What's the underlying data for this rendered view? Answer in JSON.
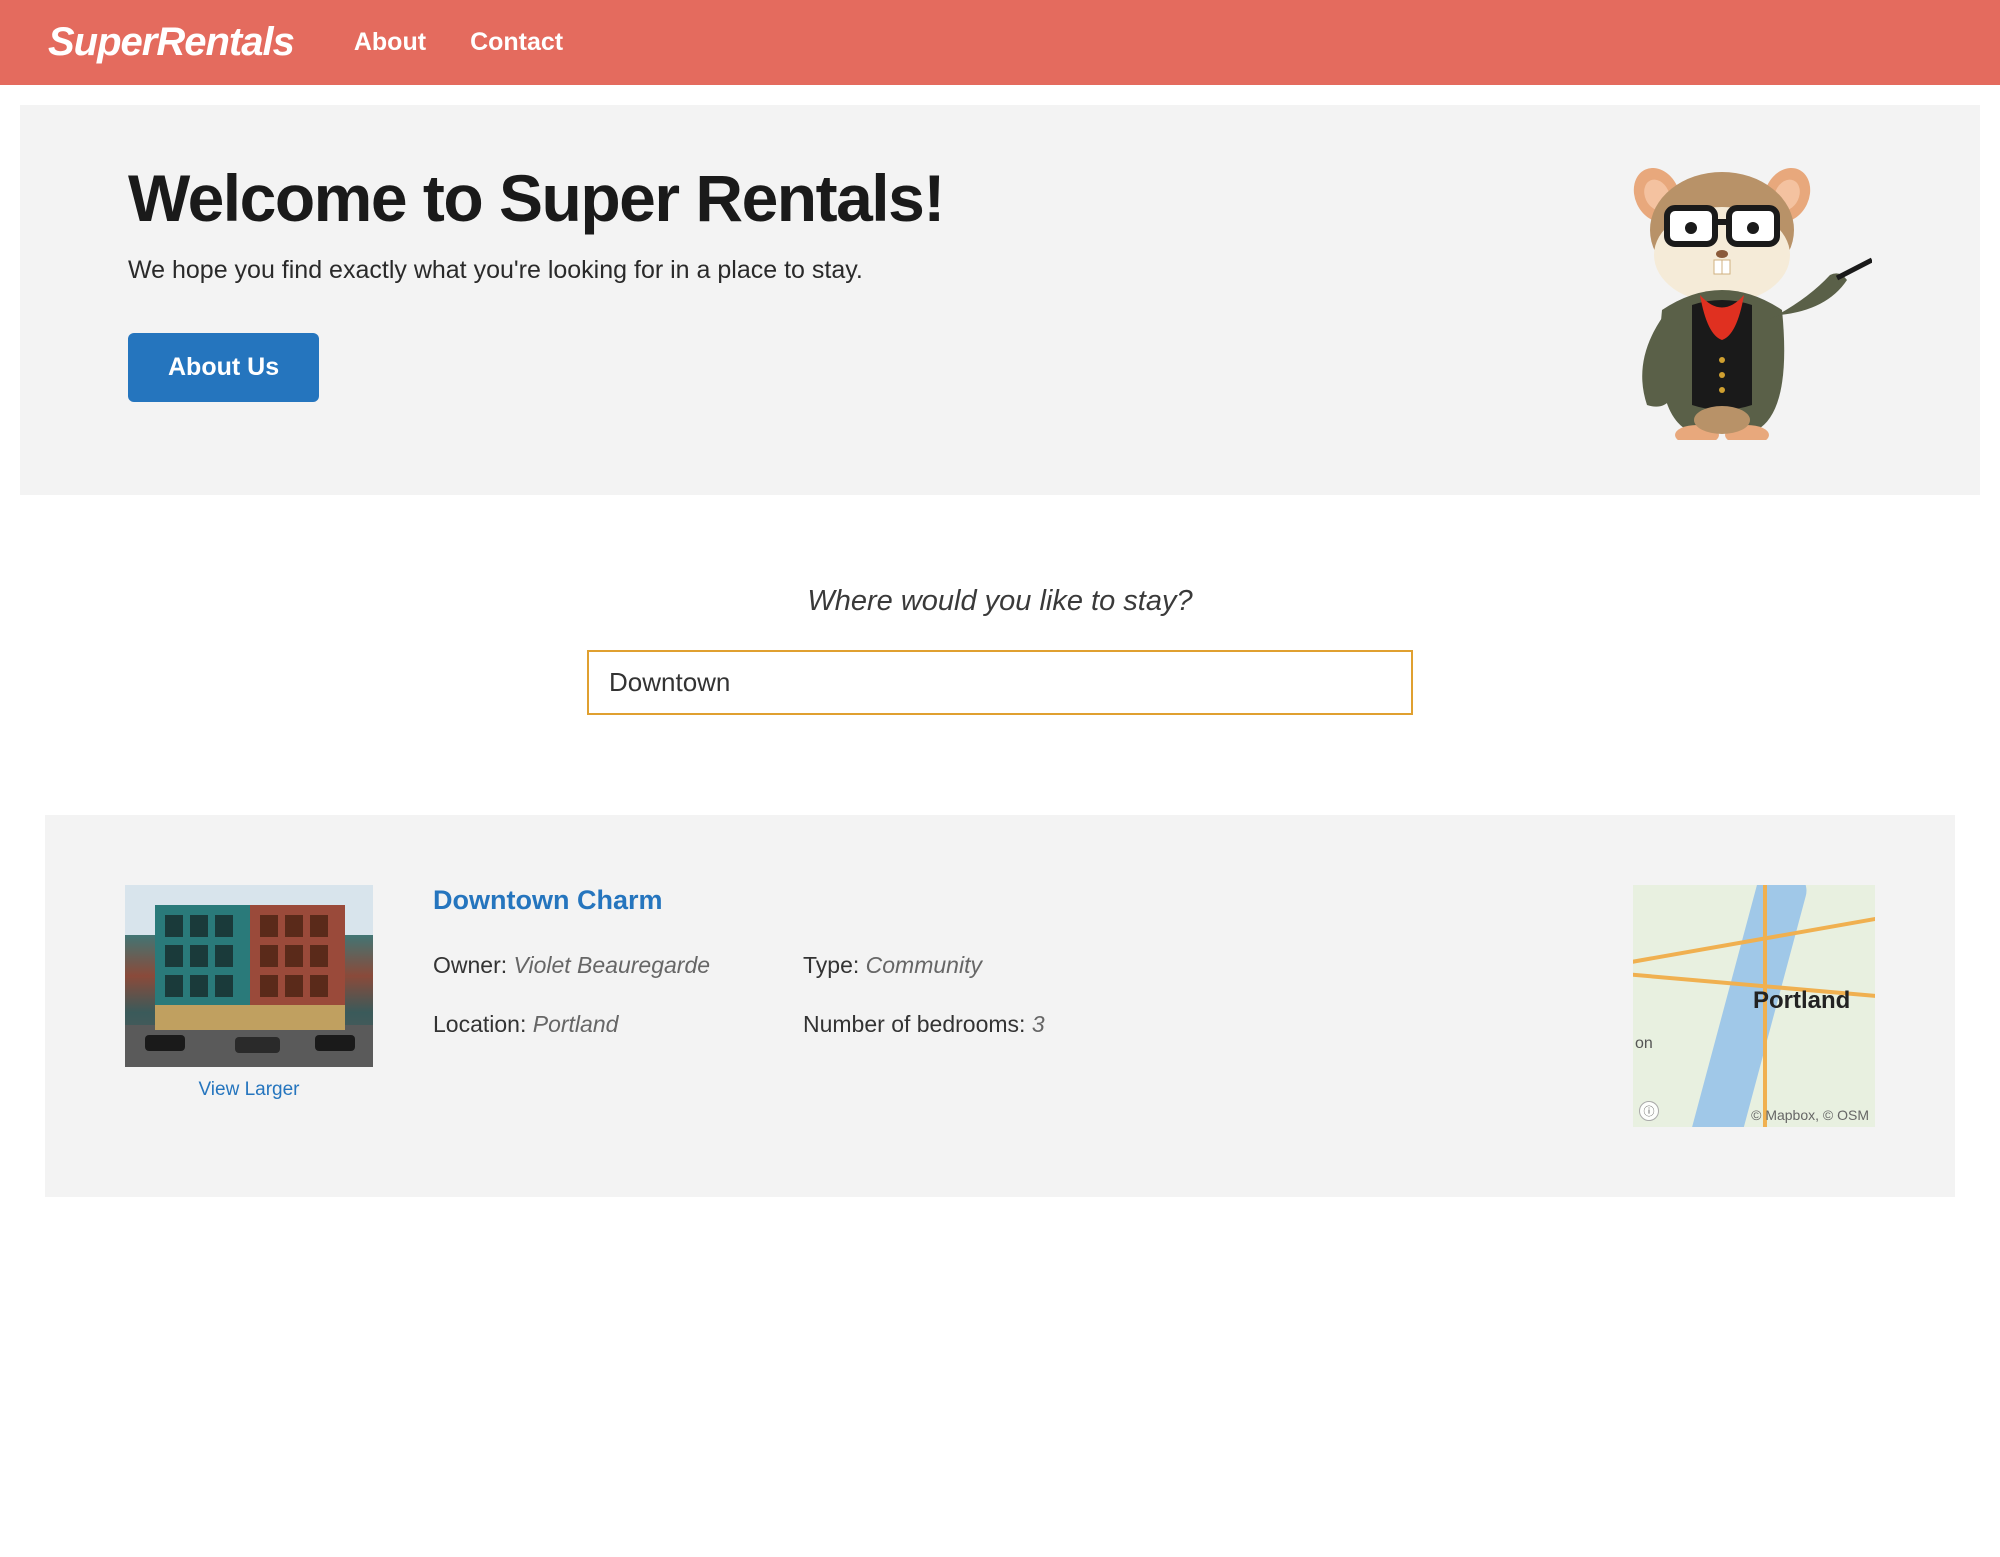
{
  "nav": {
    "logo": "SuperRentals",
    "links": [
      {
        "label": "About"
      },
      {
        "label": "Contact"
      }
    ]
  },
  "jumbo": {
    "heading": "Welcome to Super Rentals!",
    "tagline": "We hope you find exactly what you're looking for in a place to stay.",
    "button_label": "About Us"
  },
  "search": {
    "prompt": "Where would you like to stay?",
    "value": "Downtown"
  },
  "listing": {
    "title": "Downtown Charm",
    "view_larger_label": "View Larger",
    "fields": {
      "owner_label": "Owner:",
      "owner_value": "Violet Beauregarde",
      "type_label": "Type:",
      "type_value": "Community",
      "location_label": "Location:",
      "location_value": "Portland",
      "bedrooms_label": "Number of bedrooms:",
      "bedrooms_value": "3"
    },
    "map": {
      "city_label": "Portland",
      "secondary_label": "on",
      "attribution": "© Mapbox, © OSM"
    }
  }
}
